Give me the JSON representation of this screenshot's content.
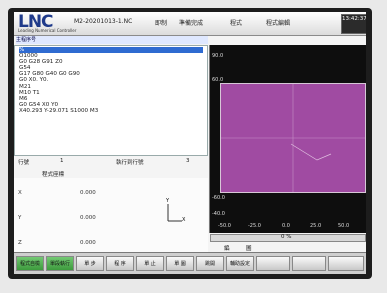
{
  "header": {
    "logo": "LNC",
    "logo_sub": "Leading Numerical Controller",
    "filename": "M2-20201013-1.NC",
    "menu": [
      "即制",
      "準備完成",
      "程式",
      "程式編輯"
    ],
    "clock": "13:42:37"
  },
  "program": {
    "subtitle": "主程序号",
    "lines": [
      "%",
      "O1000",
      "G0 G28 G91 Z0",
      "G54",
      "G17 G80 G40 G0 G90",
      "G0 X0. Y0.",
      "M21",
      "M10 T1",
      "M6",
      "G0 G54 X0 Y0",
      "X40.293 Y-29.071 S1000 M3"
    ]
  },
  "status": {
    "row_label": "行號",
    "row_value": "1",
    "exec_label": "執行到行號",
    "exec_value": "3"
  },
  "coords": {
    "title": "程式座標",
    "axes": [
      {
        "name": "X",
        "value": "0.000"
      },
      {
        "name": "Y",
        "value": "0.000"
      },
      {
        "name": "Z",
        "value": "0.000"
      }
    ],
    "triad_labels": [
      "Y",
      "X"
    ]
  },
  "plot": {
    "ticks": [
      "90.0",
      "60.0",
      "-40.0",
      "-50.0",
      "-25.0",
      "0.0",
      "25.0",
      "50.0",
      "-60.0"
    ],
    "area_color": "#a04ba2"
  },
  "progress": {
    "value": "0 %"
  },
  "mode_tabs": [
    "編輯",
    "圖形"
  ],
  "softkeys": [
    "程式自檢",
    "單段執行",
    "單 步",
    "程 序",
    "單 止",
    "單 圖",
    "跳開",
    "輔助設定",
    "",
    "",
    ""
  ]
}
